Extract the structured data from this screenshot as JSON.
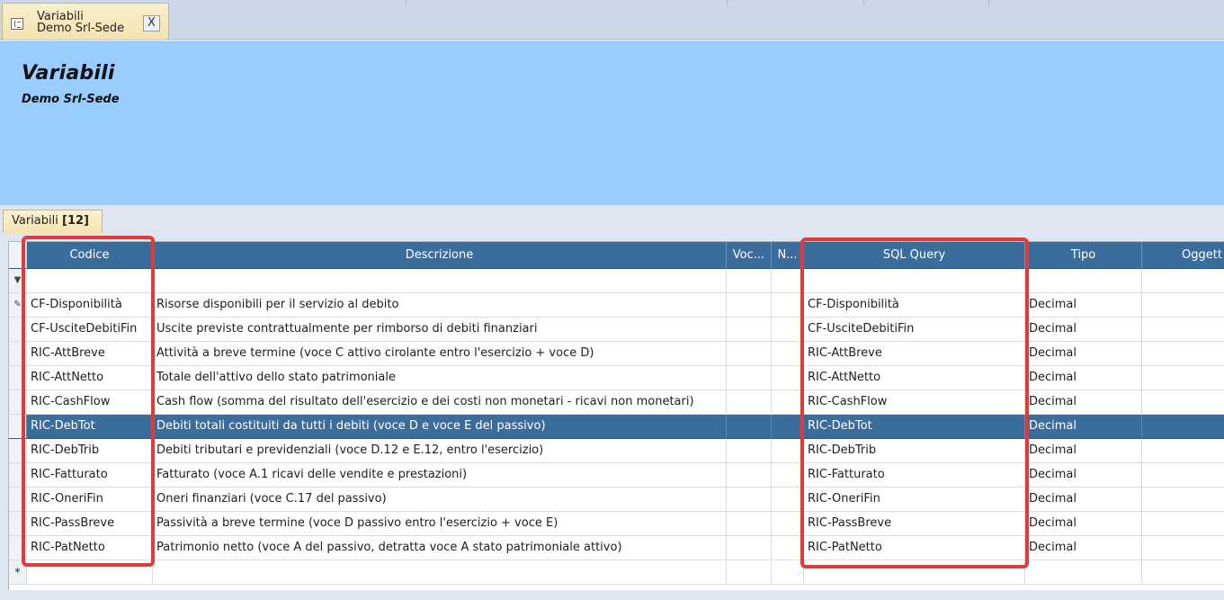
{
  "document_tab": {
    "line1": "Variabili",
    "line2": "Demo Srl-Sede",
    "close_label": "X"
  },
  "header": {
    "title": "Variabili",
    "subtitle": "Demo Srl-Sede"
  },
  "grid_tab": {
    "label": "Variabili",
    "count": "[12]"
  },
  "grid": {
    "columns": [
      "Codice",
      "Descrizione",
      "Voc...",
      "N...",
      "SQL Query",
      "Tipo",
      "Oggett"
    ],
    "filter_row_icon": "filter-icon",
    "new_row_symbol": "*",
    "selected_index": 5,
    "rows": [
      {
        "codice": "CF-Disponibilità",
        "descrizione": "Risorse disponibili per il servizio al debito",
        "sql": "CF-Disponibilità",
        "tipo": "Decimal"
      },
      {
        "codice": "CF-UsciteDebitiFin",
        "descrizione": "Uscite previste contrattualmente per rimborso di debiti finanziari",
        "sql": "CF-UsciteDebitiFin",
        "tipo": "Decimal"
      },
      {
        "codice": "RIC-AttBreve",
        "descrizione": "Attività a breve termine (voce C attivo cirolante entro l'esercizio + voce D)",
        "sql": "RIC-AttBreve",
        "tipo": "Decimal"
      },
      {
        "codice": "RIC-AttNetto",
        "descrizione": "Totale dell'attivo dello stato patrimoniale",
        "sql": "RIC-AttNetto",
        "tipo": "Decimal"
      },
      {
        "codice": "RIC-CashFlow",
        "descrizione": "Cash flow (somma del risultato dell'esercizio e dei costi non monetari - ricavi non monetari)",
        "sql": "RIC-CashFlow",
        "tipo": "Decimal"
      },
      {
        "codice": "RIC-DebTot",
        "descrizione": "Debiti totali costituiti da tutti i debiti (voce D e voce E del passivo)",
        "sql": "RIC-DebTot",
        "tipo": "Decimal"
      },
      {
        "codice": "RIC-DebTrib",
        "descrizione": "Debiti tributari e previdenziali (voce D.12 e E.12, entro l'esercizio)",
        "sql": "RIC-DebTrib",
        "tipo": "Decimal"
      },
      {
        "codice": "RIC-Fatturato",
        "descrizione": "Fatturato (voce A.1 ricavi delle vendite e prestazioni)",
        "sql": "RIC-Fatturato",
        "tipo": "Decimal"
      },
      {
        "codice": "RIC-OneriFin",
        "descrizione": "Oneri finanziari (voce C.17 del passivo)",
        "sql": "RIC-OneriFin",
        "tipo": "Decimal"
      },
      {
        "codice": "RIC-PassBreve",
        "descrizione": "Passività a breve termine (voce D passivo entro l'esercizio + voce E)",
        "sql": "RIC-PassBreve",
        "tipo": "Decimal"
      },
      {
        "codice": "RIC-PatNetto",
        "descrizione": "Patrimonio netto (voce A del passivo, detratta voce A stato patrimoniale attivo)",
        "sql": "RIC-PatNetto",
        "tipo": "Decimal"
      }
    ]
  },
  "colors": {
    "header_panel": "#99ccff",
    "grid_header": "#3a6d9c",
    "selection": "#3a6d9c",
    "highlight_box": "#e03b3b"
  }
}
